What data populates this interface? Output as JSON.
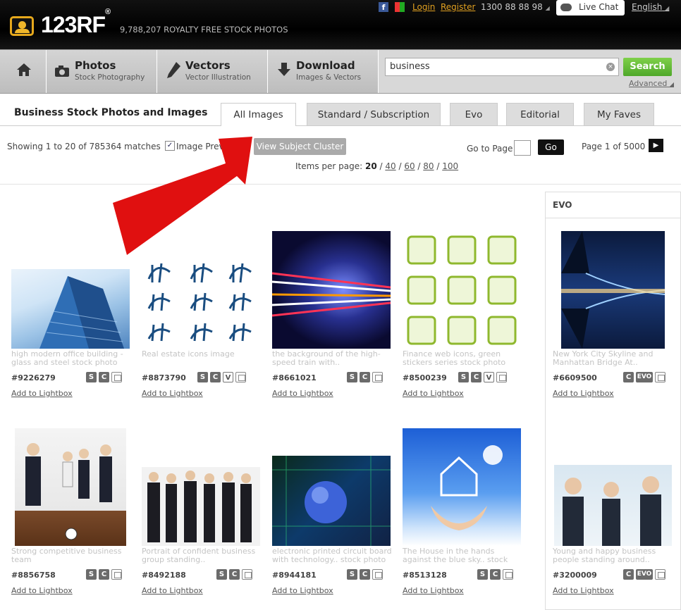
{
  "header": {
    "logo_text": "123RF",
    "logo_mark": "®",
    "tagline": "9,788,207  ROYALTY FREE STOCK PHOTOS",
    "login": "Login",
    "register": "Register",
    "phone": "1300 88 88 98",
    "live_chat": "Live Chat",
    "language": "English",
    "phone_caret": "◢",
    "language_caret": "◢"
  },
  "nav": {
    "home_icon": "home-icon",
    "items": [
      {
        "title": "Photos",
        "sub": "Stock Photography",
        "icon": "camera-icon"
      },
      {
        "title": "Vectors",
        "sub": "Vector Illustration",
        "icon": "pen-icon"
      },
      {
        "title": "Download",
        "sub": "Images & Vectors",
        "icon": "download-icon"
      }
    ]
  },
  "search": {
    "value": "business",
    "button": "Search",
    "advanced": "Advanced"
  },
  "results": {
    "title": "Business Stock Photos and Images",
    "tabs": [
      "All Images",
      "Standard / Subscription",
      "Evo",
      "Editorial",
      "My Faves"
    ],
    "active_tab": "All Images",
    "showing": "Showing 1 to 20 of 785364 matches",
    "image_previews_label": "Image Previews",
    "cluster_button": "View Subject Cluster",
    "goto_label": "Go to Page",
    "go_button": "Go",
    "page_info": "Page 1 of 5000",
    "ipp_label": "Items per page:",
    "ipp_options": [
      "20",
      "40",
      "60",
      "80",
      "100"
    ]
  },
  "sidebar": {
    "title": "EVO"
  },
  "items": [
    {
      "caption": "high modern office building - glass and steel stock photo",
      "id": "#9226279",
      "lightbox": "Add to Lightbox",
      "badges": [
        "S",
        "C",
        "stack"
      ]
    },
    {
      "caption": "Real estate icons image",
      "id": "#8873790",
      "lightbox": "Add to Lightbox",
      "badges": [
        "S",
        "C",
        "V",
        "stack"
      ]
    },
    {
      "caption": "the background of the high-speed train with..",
      "id": "#8661021",
      "lightbox": "Add to Lightbox",
      "badges": [
        "S",
        "C",
        "stack"
      ]
    },
    {
      "caption": "Finance web icons, green stickers series stock photo",
      "id": "#8500239",
      "lightbox": "Add to Lightbox",
      "badges": [
        "S",
        "C",
        "V",
        "stack"
      ]
    },
    {
      "caption": "New York City Skyline and Manhattan Bridge At..",
      "id": "#6609500",
      "lightbox": "Add to Lightbox",
      "badges": [
        "C",
        "EVO",
        "stack"
      ]
    },
    {
      "caption": "Strong competitive business team",
      "id": "#8856758",
      "lightbox": "Add to Lightbox",
      "badges": [
        "S",
        "C",
        "stack"
      ]
    },
    {
      "caption": "Portrait of confident business group standing..",
      "id": "#8492188",
      "lightbox": "Add to Lightbox",
      "badges": [
        "S",
        "C",
        "stack"
      ]
    },
    {
      "caption": "electronic printed circuit board with technology.. stock photo",
      "id": "#8944181",
      "lightbox": "Add to Lightbox",
      "badges": [
        "S",
        "C",
        "stack"
      ]
    },
    {
      "caption": "The House in the hands against the blue sky.. stock",
      "id": "#8513128",
      "lightbox": "Add to Lightbox",
      "badges": [
        "S",
        "C",
        "stack"
      ]
    },
    {
      "caption": "Young and happy business people standing around..",
      "id": "#3200009",
      "lightbox": "Add to Lightbox",
      "badges": [
        "C",
        "EVO",
        "stack"
      ]
    }
  ]
}
